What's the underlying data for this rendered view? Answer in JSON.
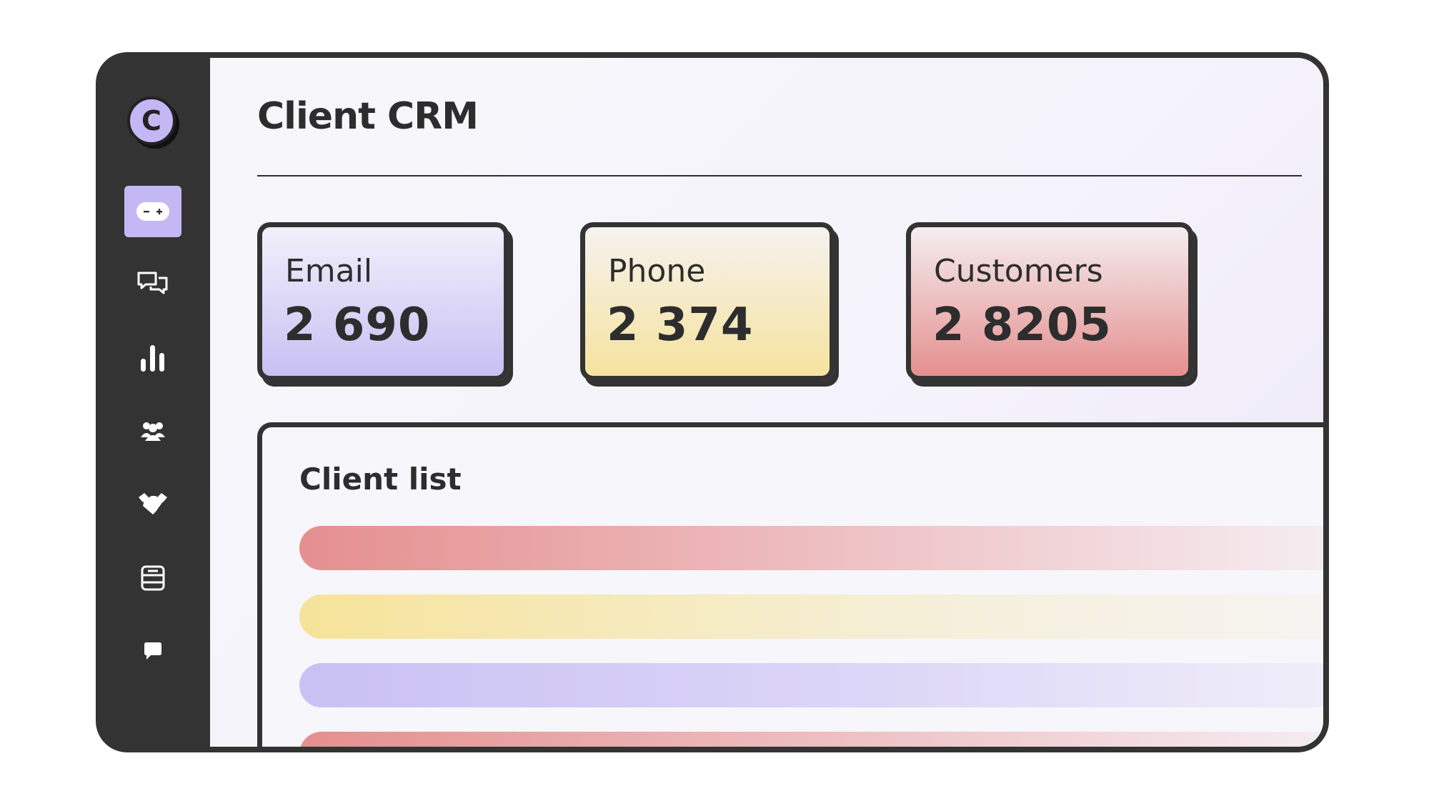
{
  "app": {
    "title": "Client CRM",
    "logo_letter": "C"
  },
  "sidebar": {
    "items": [
      {
        "name": "toggle",
        "icon": "toggle-icon",
        "active": true
      },
      {
        "name": "messages",
        "icon": "chat-bubbles-icon",
        "active": false
      },
      {
        "name": "analytics",
        "icon": "bar-chart-icon",
        "active": false
      },
      {
        "name": "team",
        "icon": "users-icon",
        "active": false
      },
      {
        "name": "deals",
        "icon": "handshake-icon",
        "active": false
      },
      {
        "name": "notes",
        "icon": "notebook-icon",
        "active": false
      },
      {
        "name": "chat",
        "icon": "chat-icon",
        "active": false
      }
    ]
  },
  "stats": [
    {
      "label": "Email",
      "value": "2 690"
    },
    {
      "label": "Phone",
      "value": "2 374"
    },
    {
      "label": "Customers",
      "value": "2 8205"
    }
  ],
  "client_list": {
    "title": "Client list",
    "rows": [
      "red",
      "yellow",
      "purple",
      "red"
    ]
  },
  "colors": {
    "frame": "#333333",
    "accent_purple": "#c4b8f4",
    "accent_yellow": "#f5e39e",
    "accent_red": "#e58f8f"
  }
}
